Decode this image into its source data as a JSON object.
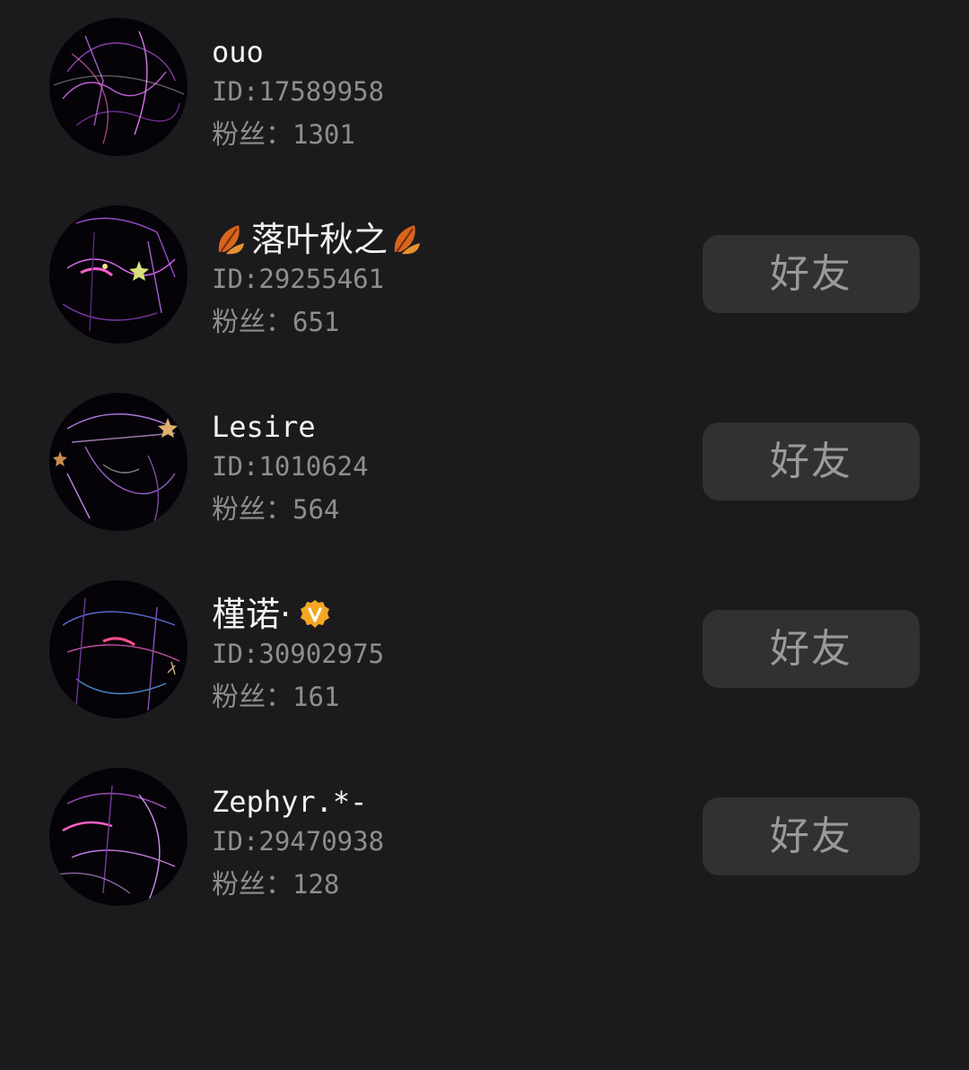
{
  "users": [
    {
      "name": "ouo",
      "id_text": "ID:17589958",
      "fans_label": "粉丝：",
      "fans_count": "1301",
      "friend_label": "",
      "has_friend_button": false
    },
    {
      "name": "落叶秋之",
      "name_icons": [
        "autumn-leaf-icon",
        "autumn-leaf-icon"
      ],
      "id_text": "ID:29255461",
      "fans_label": "粉丝：",
      "fans_count": "651",
      "friend_label": "好友",
      "has_friend_button": true
    },
    {
      "name": "Lesire",
      "id_text": "ID:1010624",
      "fans_label": "粉丝：",
      "fans_count": "564",
      "friend_label": "好友",
      "has_friend_button": true
    },
    {
      "name": "槿诺·",
      "name_icons": [
        "verified-v-badge-icon"
      ],
      "id_text": "ID:30902975",
      "fans_label": "粉丝：",
      "fans_count": "161",
      "friend_label": "好友",
      "has_friend_button": true
    },
    {
      "name": "Zephyr.*-",
      "id_text": "ID:29470938",
      "fans_label": "粉丝：",
      "fans_count": "128",
      "friend_label": "好友",
      "has_friend_button": true
    }
  ],
  "colors": {
    "background": "#1b1b1d",
    "name_text": "#f2f2f2",
    "meta_text": "#8e8e8e",
    "button_bg": "#313133",
    "button_text": "#9a9a9a",
    "badge": "#f5a623"
  }
}
